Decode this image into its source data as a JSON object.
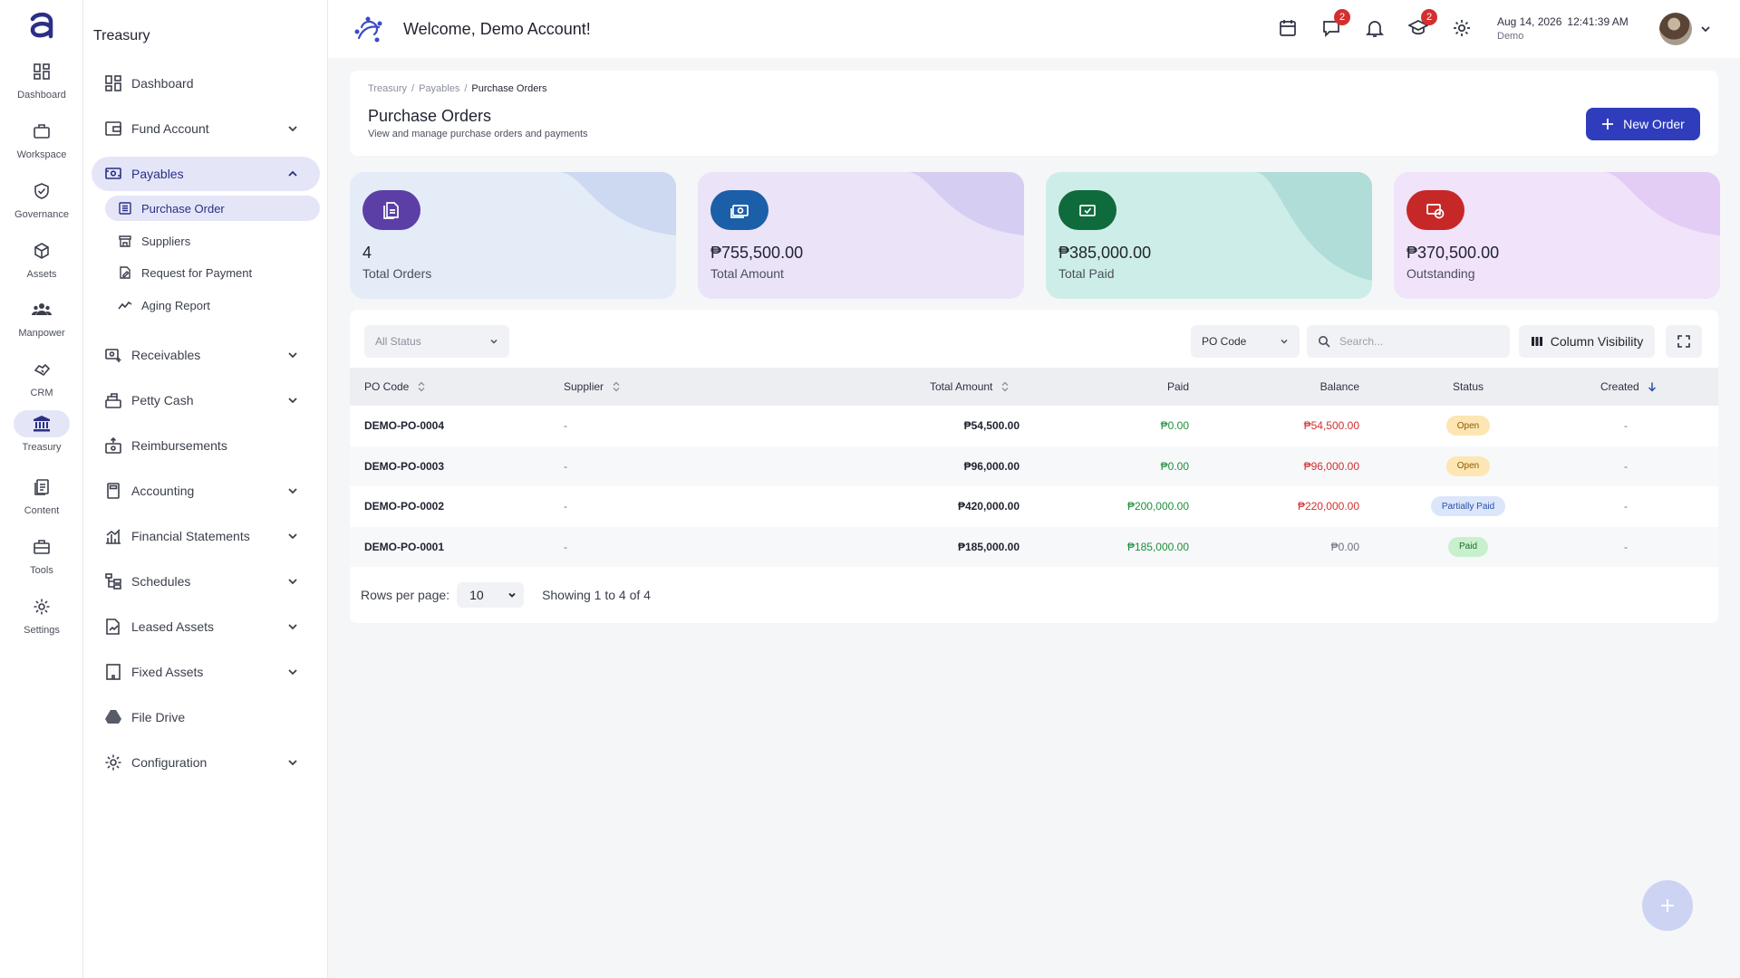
{
  "rail": {
    "items": [
      {
        "label": "Dashboard",
        "icon": "grid-icon"
      },
      {
        "label": "Workspace",
        "icon": "briefcase-icon"
      },
      {
        "label": "Governance",
        "icon": "shield-check-icon"
      },
      {
        "label": "Assets",
        "icon": "cube-icon"
      },
      {
        "label": "Manpower",
        "icon": "people-icon"
      },
      {
        "label": "CRM",
        "icon": "handshake-icon"
      },
      {
        "label": "Treasury",
        "icon": "bank-icon"
      },
      {
        "label": "Content",
        "icon": "documents-icon"
      },
      {
        "label": "Tools",
        "icon": "toolbox-icon"
      },
      {
        "label": "Settings",
        "icon": "gear-icon"
      }
    ],
    "active": "Treasury"
  },
  "sidebar": {
    "title": "Treasury",
    "items": [
      {
        "label": "Dashboard"
      },
      {
        "label": "Fund Account"
      },
      {
        "label": "Payables"
      },
      {
        "label": "Receivables"
      },
      {
        "label": "Petty Cash"
      },
      {
        "label": "Reimbursements"
      },
      {
        "label": "Accounting"
      },
      {
        "label": "Financial Statements"
      },
      {
        "label": "Schedules"
      },
      {
        "label": "Leased Assets"
      },
      {
        "label": "Fixed Assets"
      },
      {
        "label": "File Drive"
      },
      {
        "label": "Configuration"
      }
    ],
    "payables_sub": [
      {
        "label": "Purchase Order"
      },
      {
        "label": "Suppliers"
      },
      {
        "label": "Request for Payment"
      },
      {
        "label": "Aging Report"
      }
    ]
  },
  "header": {
    "welcome": "Welcome, Demo Account!",
    "messages_badge": "2",
    "learning_badge": "2",
    "date": "Aug 14, 2026",
    "time": "12:41:39 AM",
    "user": "Demo"
  },
  "page": {
    "breadcrumb": [
      "Treasury",
      "Payables",
      "Purchase Orders"
    ],
    "title": "Purchase Orders",
    "subtitle": "View and manage purchase orders and payments",
    "new_button": "New Order"
  },
  "stats": [
    {
      "value": "4",
      "label": "Total Orders",
      "icon": "document-icon",
      "bg": "#e4ecf8",
      "accent": "#5b3fa6",
      "deco": "#cdd9f0"
    },
    {
      "value": "₱755,500.00",
      "label": "Total Amount",
      "icon": "cash-icon",
      "bg": "#ebe3f8",
      "accent": "#1b5fa8",
      "deco": "#d6cdf3"
    },
    {
      "value": "₱385,000.00",
      "label": "Total Paid",
      "icon": "cash-check-icon",
      "bg": "#cdeee8",
      "accent": "#0f6b3c",
      "deco": "#b0ddd7"
    },
    {
      "value": "₱370,500.00",
      "label": "Outstanding",
      "icon": "cash-clock-icon",
      "bg": "#f1e3fa",
      "accent": "#c62828",
      "deco": "#e3cdf5"
    }
  ],
  "filters": {
    "status_placeholder": "All Status",
    "search_field": "PO Code",
    "search_placeholder": "Search...",
    "column_visibility": "Column Visibility"
  },
  "table": {
    "headers": {
      "po_code": "PO Code",
      "supplier": "Supplier",
      "total": "Total Amount",
      "paid": "Paid",
      "balance": "Balance",
      "status": "Status",
      "created": "Created"
    },
    "rows": [
      {
        "po_code": "DEMO-PO-0004",
        "supplier": "-",
        "total": "₱54,500.00",
        "paid": "₱0.00",
        "balance": "₱54,500.00",
        "status": "Open",
        "created": "-"
      },
      {
        "po_code": "DEMO-PO-0003",
        "supplier": "-",
        "total": "₱96,000.00",
        "paid": "₱0.00",
        "balance": "₱96,000.00",
        "status": "Open",
        "created": "-"
      },
      {
        "po_code": "DEMO-PO-0002",
        "supplier": "-",
        "total": "₱420,000.00",
        "paid": "₱200,000.00",
        "balance": "₱220,000.00",
        "status": "Partially Paid",
        "created": "-"
      },
      {
        "po_code": "DEMO-PO-0001",
        "supplier": "-",
        "total": "₱185,000.00",
        "paid": "₱185,000.00",
        "balance": "₱0.00",
        "status": "Paid",
        "created": "-"
      }
    ]
  },
  "pagination": {
    "rows_per_page_label": "Rows per page:",
    "rows_per_page": "10",
    "showing": "Showing 1 to 4 of 4"
  }
}
